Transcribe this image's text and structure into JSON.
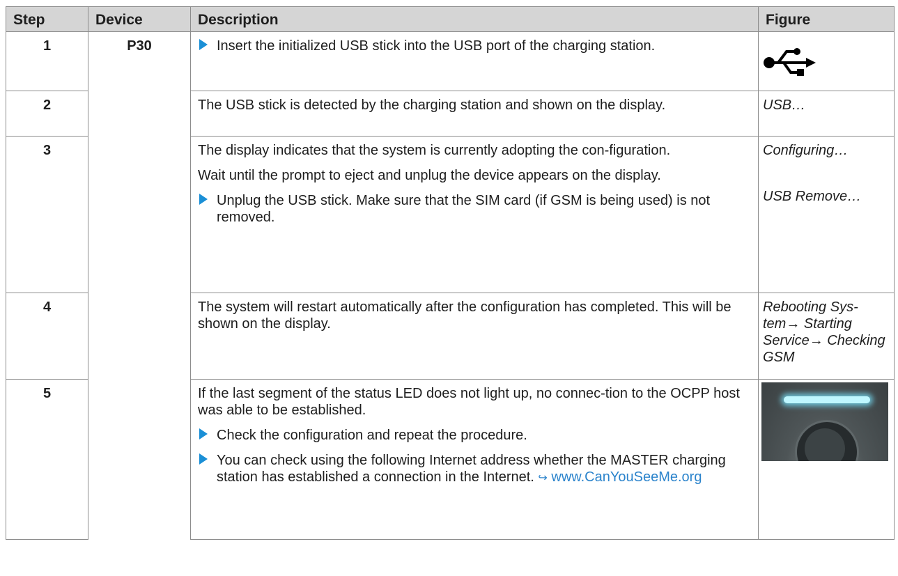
{
  "headers": {
    "step": "Step",
    "device": "Device",
    "description": "Description",
    "figure": "Figure"
  },
  "device": "P30",
  "rows": [
    {
      "step": "1",
      "desc": [
        {
          "bullet": true,
          "text": "Insert the initialized USB stick into the USB port of the charging station."
        }
      ],
      "figure_icon": "usb-icon"
    },
    {
      "step": "2",
      "desc": [
        {
          "bullet": false,
          "text": "The USB stick is detected by the charging station and shown on the display."
        }
      ],
      "figure": "USB…"
    },
    {
      "step": "3",
      "desc": [
        {
          "bullet": false,
          "text": "The display indicates that the system is currently adopting the con-figuration."
        },
        {
          "bullet": false,
          "text": "Wait until the prompt to eject and unplug the device appears on the display."
        },
        {
          "bullet": true,
          "text": "Unplug the USB stick. Make sure that the SIM card (if GSM is being used) is not removed."
        }
      ],
      "figure": "Configuring…",
      "figure2": "USB Remove…"
    },
    {
      "step": "4",
      "desc": [
        {
          "bullet": false,
          "text": "The system will restart automatically after the configuration has completed. This will be shown on the display."
        }
      ],
      "figure": "Rebooting Sys-tem→ Starting Service→ Checking GSM"
    },
    {
      "step": "5",
      "desc": [
        {
          "bullet": false,
          "text": "If the last segment of the status LED does not light up, no connec-tion to the OCPP host was able to be established."
        },
        {
          "bullet": true,
          "text": "Check the configuration and repeat the procedure."
        },
        {
          "bullet": true,
          "text": "You can check using the following Internet address whether the MASTER charging station has established a connection in the Internet."
        }
      ],
      "link_arrow": "↪",
      "link": "www.CanYouSeeMe.org",
      "figure_icon": "status-led-photo"
    }
  ]
}
